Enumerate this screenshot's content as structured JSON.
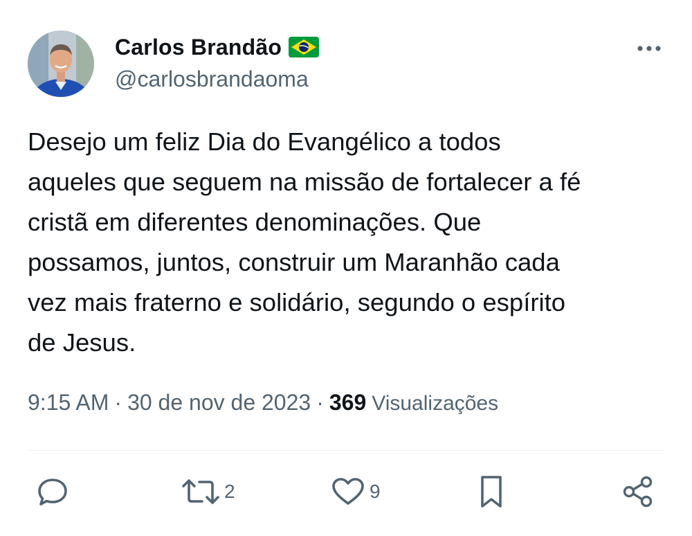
{
  "author": {
    "display_name": "Carlos Brandão",
    "handle": "@carlosbrandaoma",
    "flag_icon": "brazil-flag-icon"
  },
  "tweet": {
    "text": "Desejo um feliz Dia do Evangélico a todos\naqueles que seguem na missão de fortalecer a fé\ncristã em diferentes denominações. Que\npossamos, juntos, construir um Maranhão cada\nvez mais fraterno e solidário, segundo o espírito\nde Jesus."
  },
  "meta": {
    "time": "9:15 AM",
    "separator": "·",
    "date": "30 de nov de 2023",
    "views_count": "369",
    "views_label": "Visualizações"
  },
  "actions": {
    "reply_icon": "reply-icon",
    "retweet_icon": "retweet-icon",
    "retweet_count": "2",
    "like_icon": "heart-icon",
    "like_count": "9",
    "bookmark_icon": "bookmark-icon",
    "share_icon": "share-icon"
  },
  "colors": {
    "text_primary": "#0f1419",
    "text_secondary": "#536471",
    "divider": "#eff3f4",
    "flag_green": "#009c3b",
    "flag_yellow": "#ffdf00",
    "flag_blue": "#002776"
  }
}
